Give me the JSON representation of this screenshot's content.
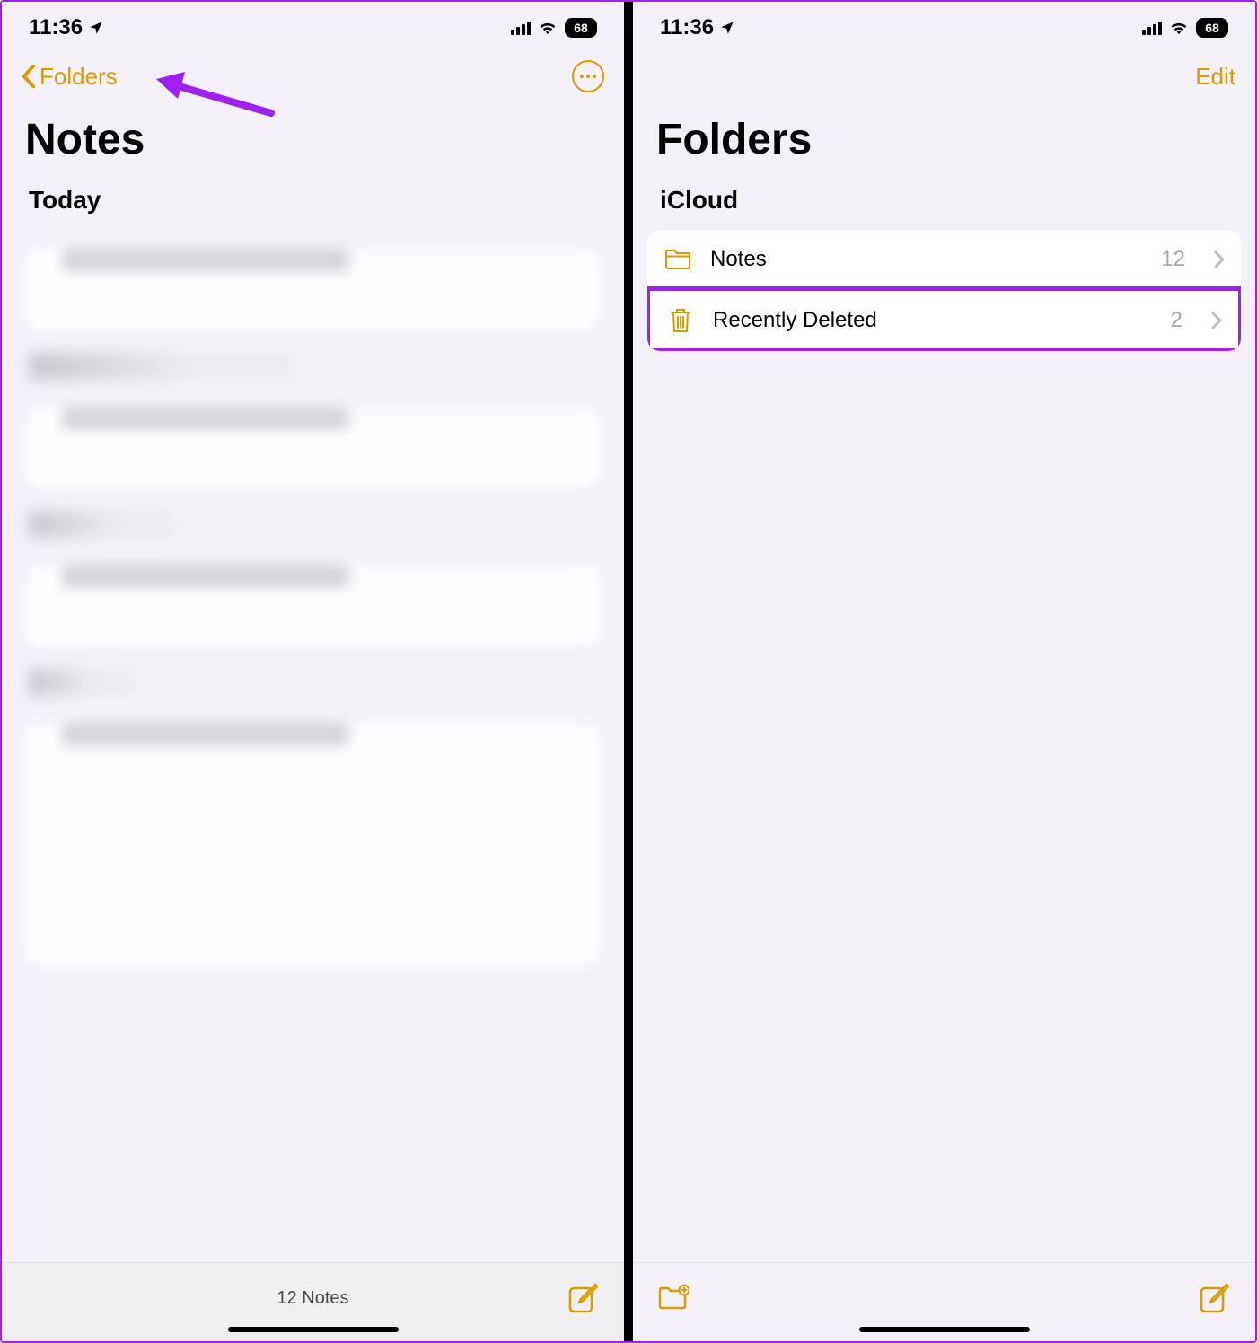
{
  "status": {
    "time": "11:36",
    "battery": "68"
  },
  "phone1": {
    "backLabel": "Folders",
    "title": "Notes",
    "sectionHeader": "Today",
    "toolbarCount": "12 Notes",
    "blurredSectionLabels": [
      "P",
      "J",
      "2"
    ]
  },
  "phone2": {
    "editLabel": "Edit",
    "title": "Folders",
    "groupHeader": "iCloud",
    "folders": [
      {
        "icon": "folder",
        "label": "Notes",
        "count": "12",
        "highlighted": false
      },
      {
        "icon": "trash",
        "label": "Recently Deleted",
        "count": "2",
        "highlighted": true
      }
    ]
  },
  "colors": {
    "accent": "#d89b00",
    "annotation": "#a020f0"
  }
}
